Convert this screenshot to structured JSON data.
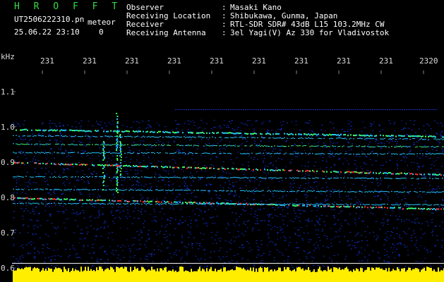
{
  "header": {
    "program_title": "H R O F F T",
    "file_name": "UT2506222310.pn",
    "file_name_suffix": "meteor",
    "date_time": "25.06.22 23:10",
    "counter": "0",
    "info": [
      {
        "label": "Observer",
        "sep": ":",
        "value": "Masaki Kano"
      },
      {
        "label": "Receiving Location",
        "sep": ":",
        "value": "Shibukawa, Gunma, Japan"
      },
      {
        "label": "Receiver",
        "sep": ":",
        "value": "RTL-SDR SDR# 43dB L15 103.2MHz CW"
      },
      {
        "label": "Receiving Antenna",
        "sep": ":",
        "value": "3el Yagi(V) Az 330 for Vladivostok"
      }
    ]
  },
  "axes": {
    "y_unit": "kHz",
    "y_ticks": [
      "1.1",
      "1.0",
      "0.9",
      "0.8",
      "0.7",
      "0.6"
    ],
    "x_ticks": [
      "231",
      "231",
      "231",
      "231",
      "231",
      "231",
      "231",
      "231",
      "231",
      "2320"
    ]
  },
  "colors": {
    "background": "#000000",
    "spectrum_blue": "#1030c8",
    "signal_cyan": "#20c8ff",
    "signal_green": "#40ff60",
    "signal_red": "#ff3030",
    "audio_level": "#ffee00"
  }
}
